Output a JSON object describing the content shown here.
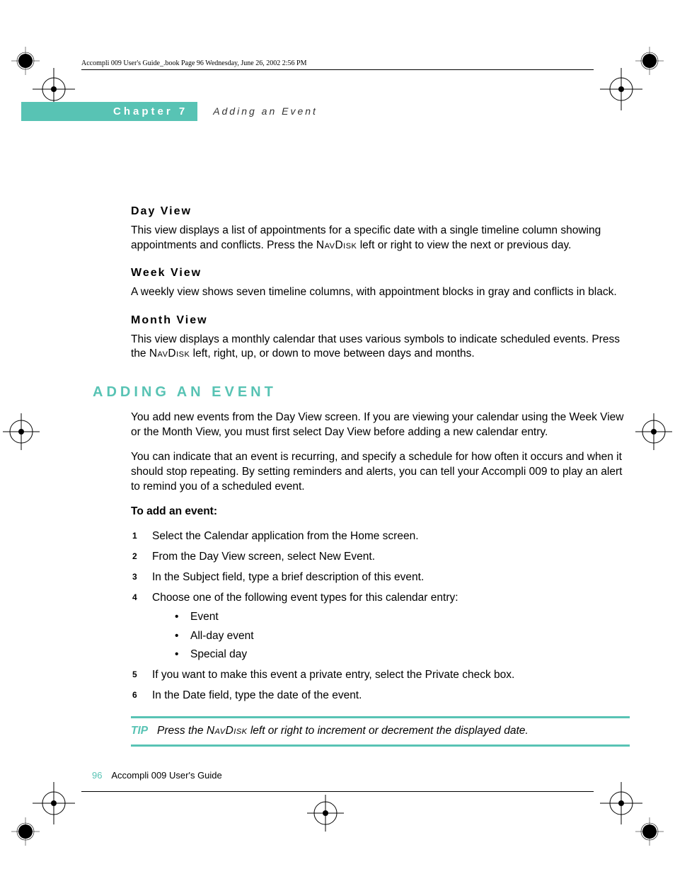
{
  "meta_line": "Accompli 009 User's Guide_.book  Page 96  Wednesday, June 26, 2002  2:56 PM",
  "chapter": {
    "label": "Chapter 7",
    "subtitle": "Adding an Event"
  },
  "day_view": {
    "title": "Day View",
    "text_a": "This view displays a list of appointments for a specific date with a single timeline column showing appointments and conflicts. Press the ",
    "nav": "NavDisk",
    "text_b": " left or right to view the next or previous day."
  },
  "week_view": {
    "title": "Week View",
    "text": "A weekly view shows seven timeline columns, with appointment blocks in gray and conflicts in black."
  },
  "month_view": {
    "title": "Month View",
    "text_a": "This view displays a monthly calendar that uses various symbols to indicate scheduled events. Press the ",
    "nav": "NavDisk",
    "text_b": " left, right, up, or down to move between days and months."
  },
  "adding": {
    "title": "ADDING AN EVENT",
    "p1": "You add new events from the Day View screen. If you are viewing your calendar using the Week View or the Month View, you must first select Day View before adding a new calendar entry.",
    "p2": "You can indicate that an event is recurring, and specify a schedule for how often it occurs and when it should stop repeating. By setting reminders and alerts, you can tell your Accompli 009 to play an alert to remind you of a scheduled event.",
    "lead": "To add an event:",
    "steps": [
      "Select the Calendar application from the Home screen.",
      "From the Day View screen, select New Event.",
      "In the Subject field, type a brief description of this event.",
      "Choose one of the following event types for this calendar entry:",
      "If you want to make this event a private entry, select the Private check box.",
      "In the Date field, type the date of the event."
    ],
    "bullets": [
      "Event",
      "All-day event",
      "Special day"
    ]
  },
  "tip": {
    "label": "TIP",
    "text_a": "Press the ",
    "nav": "NavDisk",
    "text_b": " left or right to increment or decrement the displayed date."
  },
  "footer": {
    "page": "96",
    "title": "Accompli 009 User's Guide"
  }
}
